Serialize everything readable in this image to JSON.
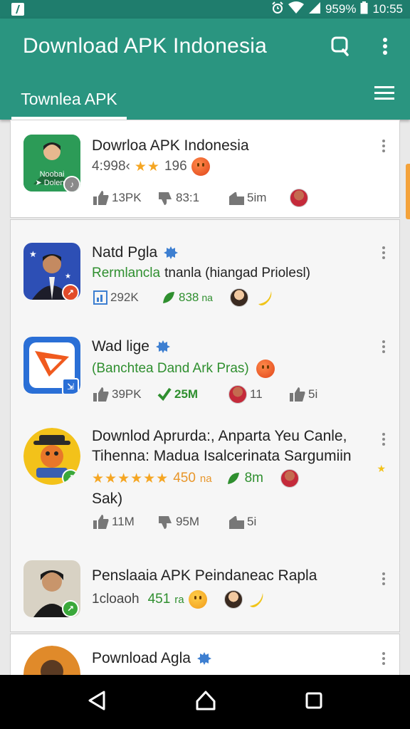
{
  "status_bar": {
    "battery": "95%",
    "battery_display": "959%",
    "time": "10:55"
  },
  "app_bar": {
    "title": "Download APK Indonesia",
    "tab_label": "Townlea APK"
  },
  "colors": {
    "primary": "#2a9580",
    "status": "#1f7d6d",
    "accent_green": "#2f8f2f",
    "star": "#f5a623"
  },
  "icons": [
    "search-icon",
    "more-vert-icon",
    "hamburger-menu-icon",
    "back-icon",
    "home-icon",
    "recents-icon"
  ],
  "items": [
    {
      "title": "Dowrloa APK Indonesia",
      "subtitle_prefix": "4:998‹",
      "rating_count": "196",
      "avatar_caption_1": "Noobai",
      "avatar_caption_2": "➤ Doleni-",
      "stats": {
        "likes": "13PK",
        "shares": "83:1",
        "time": "5im"
      }
    },
    {
      "title": "Natd Pgla",
      "subtitle_green": "Rermlancla",
      "subtitle_rest": "tnanla (hiangad Priolesl)",
      "stats": {
        "views": "292K",
        "downloads": "838",
        "downloads_unit": "na"
      }
    },
    {
      "title": "Wad lige",
      "subtitle_green": "(Banchtea Dand Ark Pras)",
      "stats": {
        "likes": "39PK",
        "downloads": "25M",
        "count": "11",
        "extra": "5i"
      }
    },
    {
      "title_line1": "Downlod Aprurda:, Anparta Yeu Canle,",
      "title_line2": "Tihenna: Madua Isalcerinata Sargumiin",
      "title_line3": "Sak)",
      "rating_value": "450",
      "rating_unit": "na",
      "downloads": "8m",
      "stats": {
        "likes": "11M",
        "shares": "95M",
        "extra": "5i"
      }
    },
    {
      "title": "Penslaaia APK Peindaneac Rapla",
      "subtitle": "1cloaoh",
      "count": "451",
      "count_unit": "ra"
    },
    {
      "title": "Pownload Agla"
    }
  ]
}
